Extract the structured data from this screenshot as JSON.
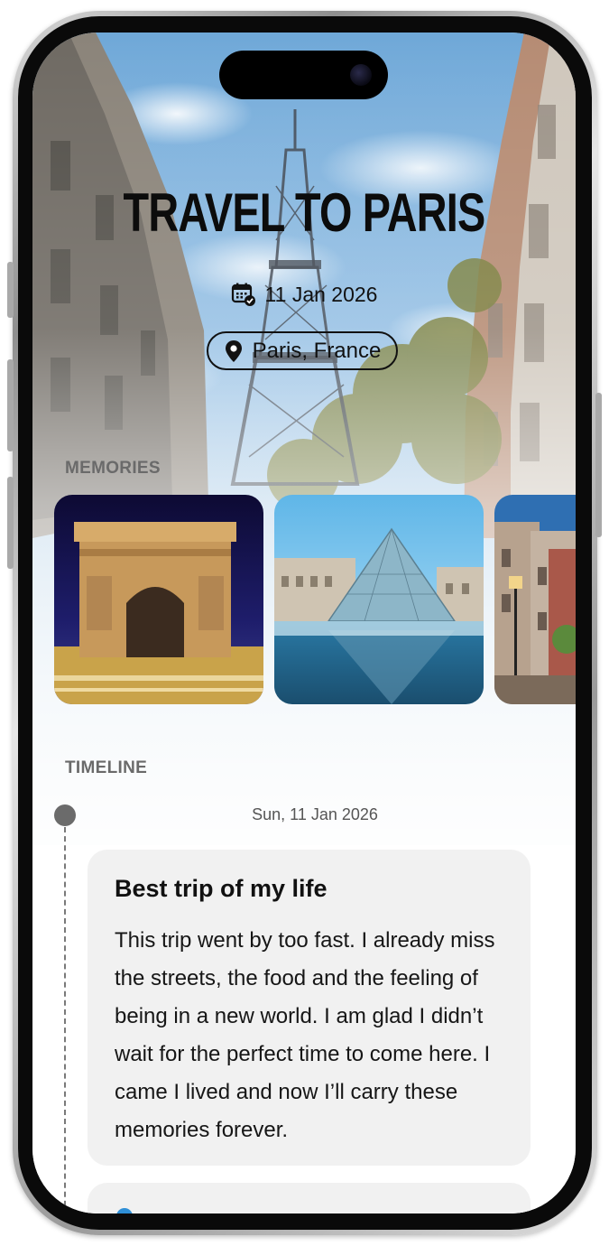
{
  "trip": {
    "title": "TRAVEL TO PARIS",
    "date": "11 Jan 2026",
    "location": "Paris, France"
  },
  "icons": {
    "date": "calendar-check-icon",
    "location": "map-pin-icon"
  },
  "memories": {
    "label": "MEMORIES",
    "photos": [
      "arc-de-triomphe-photo",
      "louvre-pyramid-photo",
      "paris-street-photo"
    ]
  },
  "timeline": {
    "label": "TIMELINE",
    "entries": [
      {
        "date": "Sun, 11 Jan 2026",
        "title": "Best trip of my life",
        "body": "This trip went by too fast. I already miss the streets, the food and the feeling of being in a new world. I am glad I didn’t wait for the perfect time to come here. I came I lived and now I’ll carry these memories forever."
      }
    ]
  },
  "colors": {
    "text": "#111111",
    "section_label": "#6a6a6a",
    "card_bg": "#f1f1f1",
    "timeline_dot": "#6b6b6b"
  }
}
